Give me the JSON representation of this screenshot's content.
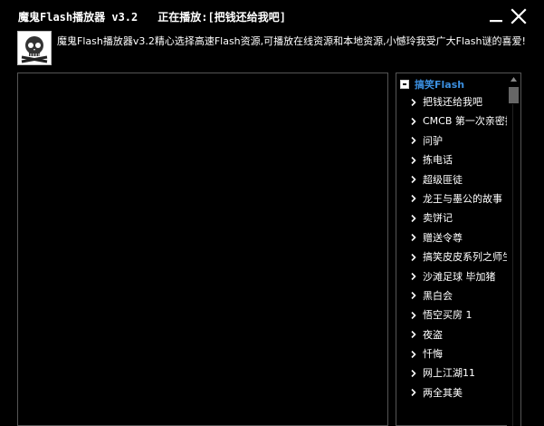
{
  "window": {
    "app_title": "魔鬼Flash播放器 v3.2",
    "now_playing": "正在播放:[把钱还给我吧]"
  },
  "header": {
    "description": "魔鬼Flash播放器v3.2精心选择高速Flash资源,可播放在线资源和本地资源,小憾玲我受广大Flash谜的喜爱!"
  },
  "playlist": {
    "category": "搞笑Flash",
    "items": [
      "把钱还给我吧",
      "CMCB 第一次亲密接",
      "问驴",
      "拣电话",
      "超级匪徒",
      "龙王与墨公的故事",
      "卖饼记",
      "赠送令尊",
      "搞笑皮皮系列之师生",
      "沙滩足球 毕加猪",
      "黑白会",
      "悟空买房 1",
      "夜盗",
      "忏悔",
      "网上江湖11",
      "两全其美"
    ]
  },
  "icons": {
    "minimize": "minimize-icon",
    "close": "close-icon",
    "logo": "skull-crossbones-icon",
    "collapse": "collapse-minus-icon",
    "chevron": "chevron-right-icon",
    "scroll_up": "scroll-up-arrow-icon"
  },
  "colors": {
    "background": "#000000",
    "category": "#3b8fe0",
    "text": "#ffffff",
    "border": "#555555"
  }
}
